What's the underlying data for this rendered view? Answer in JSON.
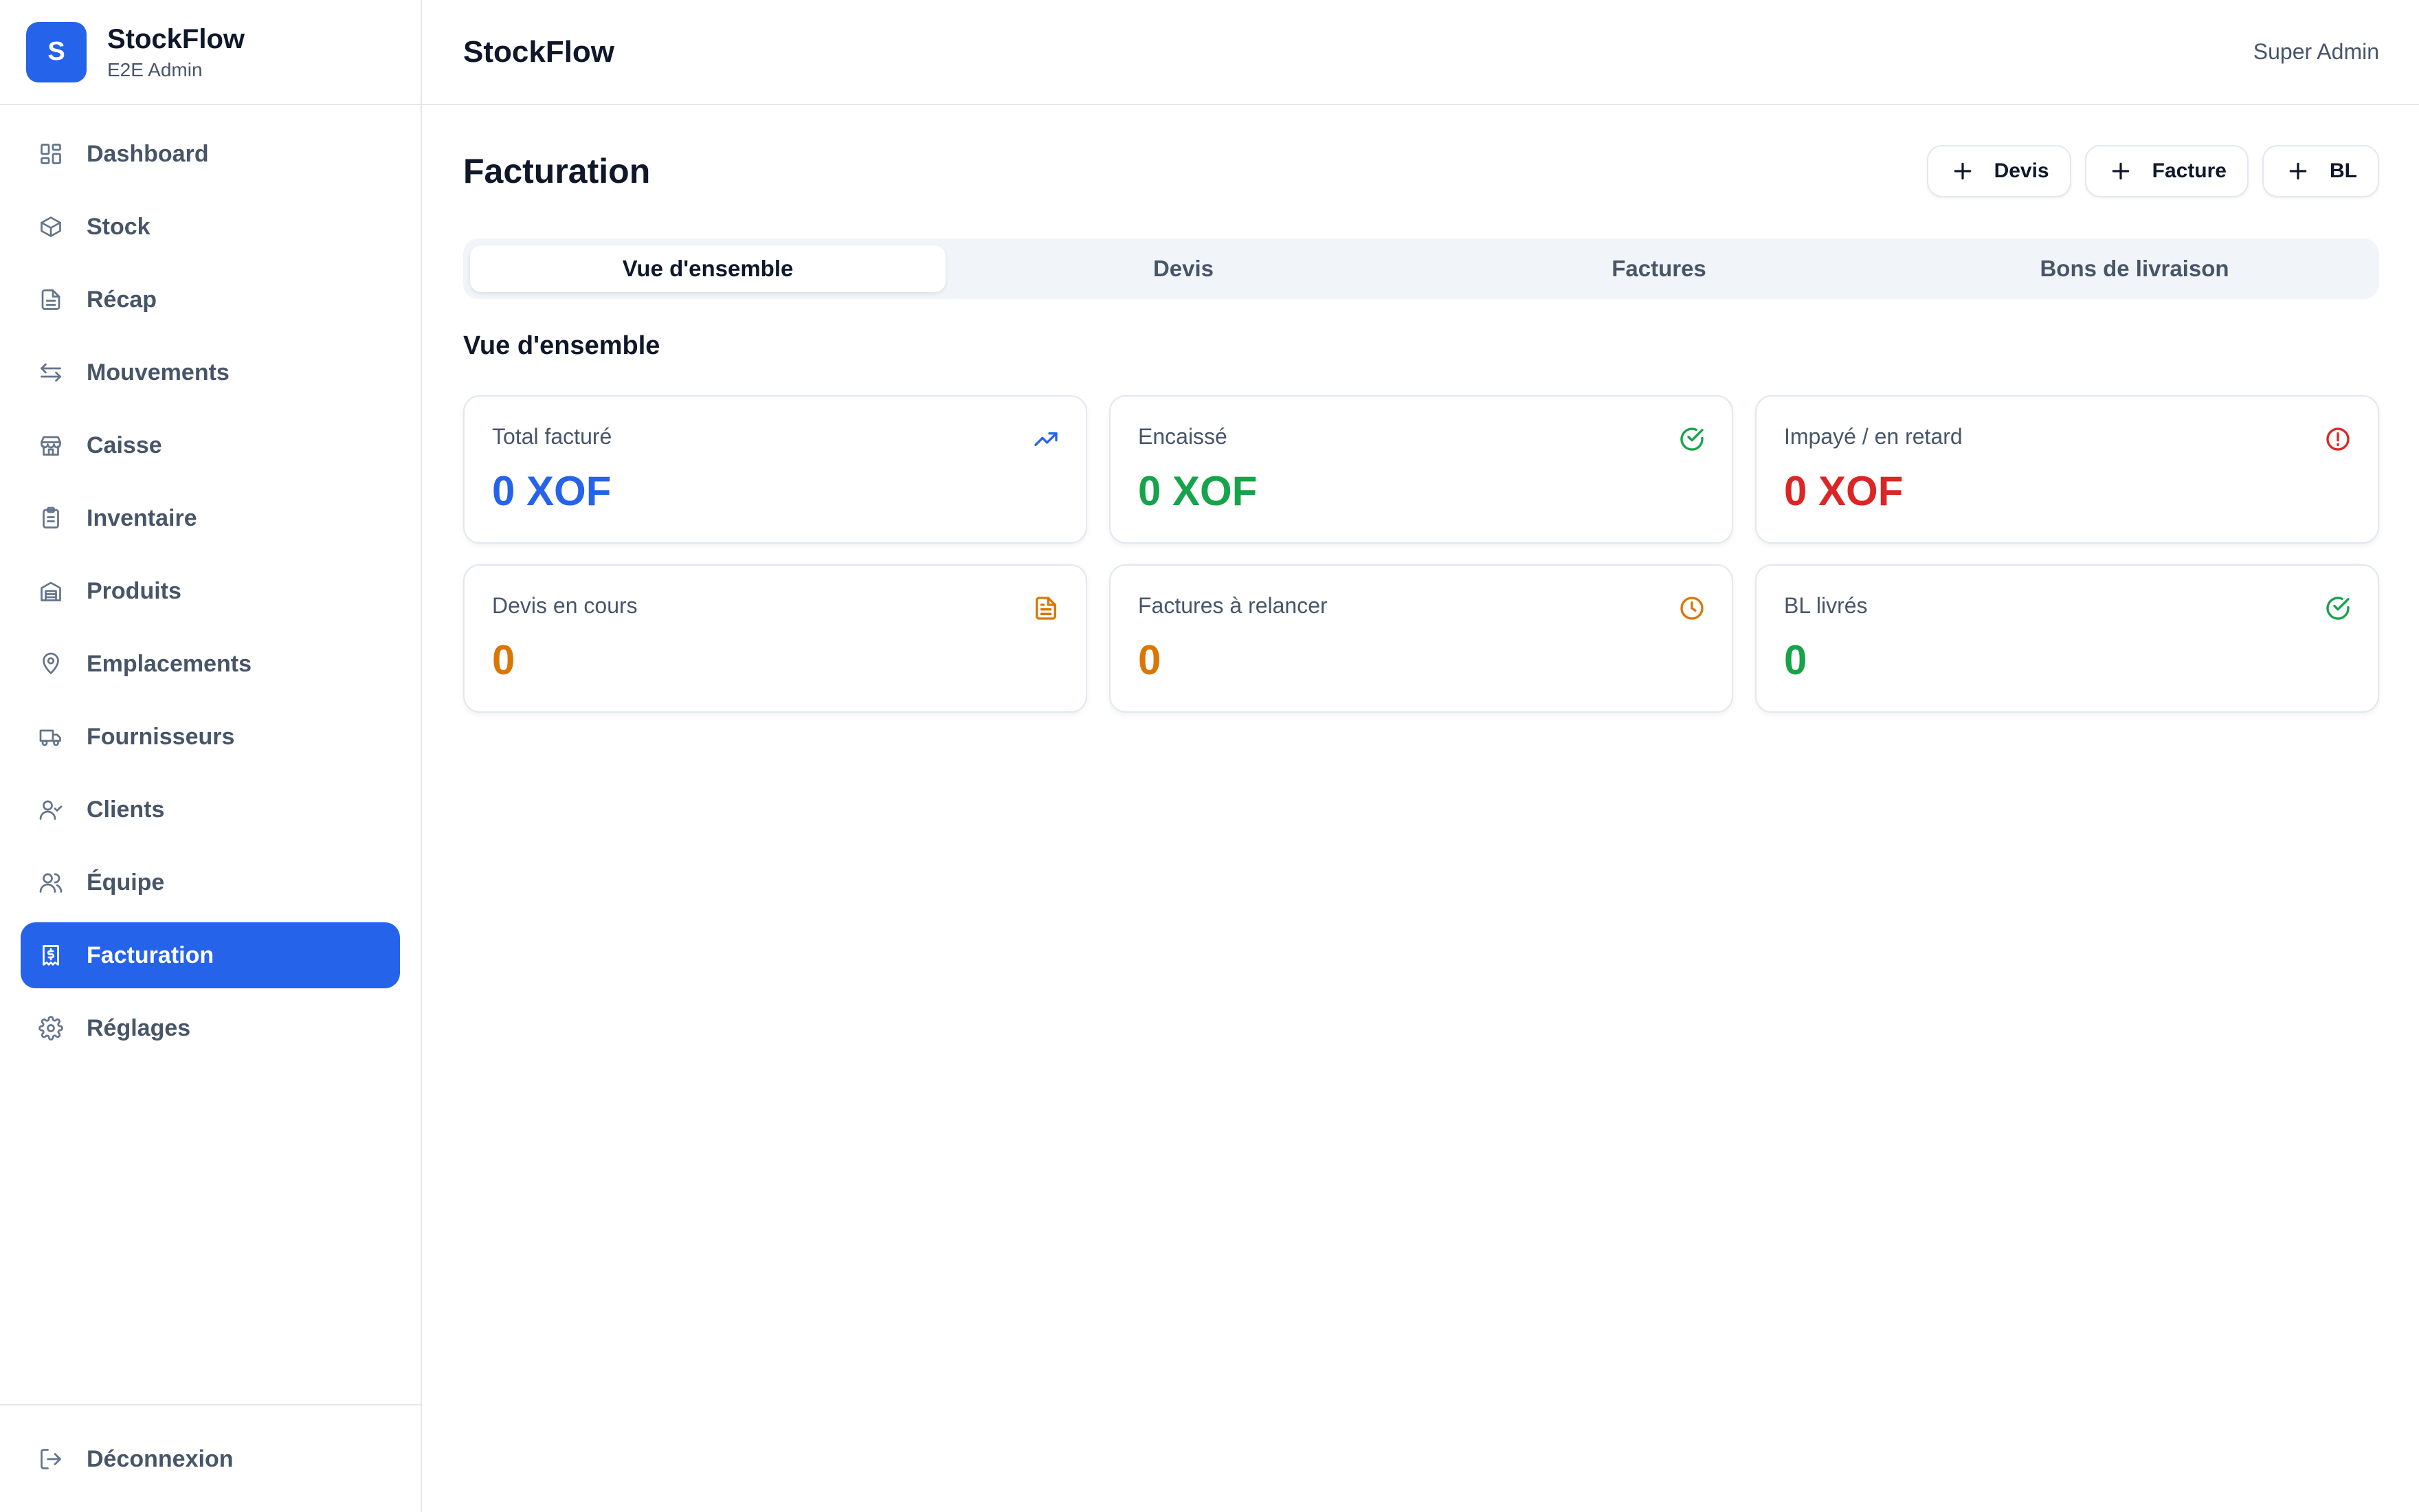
{
  "brand": {
    "logo_letter": "S",
    "name": "StockFlow",
    "subtitle": "E2E Admin"
  },
  "sidebar": {
    "items": [
      {
        "label": "Dashboard",
        "icon": "dashboard-grid-icon"
      },
      {
        "label": "Stock",
        "icon": "box-icon"
      },
      {
        "label": "Récap",
        "icon": "document-icon"
      },
      {
        "label": "Mouvements",
        "icon": "arrows-exchange-icon"
      },
      {
        "label": "Caisse",
        "icon": "store-icon"
      },
      {
        "label": "Inventaire",
        "icon": "clipboard-icon"
      },
      {
        "label": "Produits",
        "icon": "warehouse-icon"
      },
      {
        "label": "Emplacements",
        "icon": "map-pin-icon"
      },
      {
        "label": "Fournisseurs",
        "icon": "truck-icon"
      },
      {
        "label": "Clients",
        "icon": "user-check-icon"
      },
      {
        "label": "Équipe",
        "icon": "users-icon"
      },
      {
        "label": "Facturation",
        "icon": "receipt-icon",
        "active": true
      },
      {
        "label": "Réglages",
        "icon": "gear-icon"
      }
    ],
    "logout_label": "Déconnexion"
  },
  "topbar": {
    "title": "StockFlow",
    "user": "Super Admin"
  },
  "page": {
    "title": "Facturation",
    "actions": [
      {
        "label": "Devis"
      },
      {
        "label": "Facture"
      },
      {
        "label": "BL"
      }
    ],
    "tabs": [
      {
        "label": "Vue d'ensemble",
        "active": true
      },
      {
        "label": "Devis"
      },
      {
        "label": "Factures"
      },
      {
        "label": "Bons de livraison"
      }
    ],
    "section_title": "Vue d'ensemble",
    "cards": [
      {
        "label": "Total facturé",
        "value": "0 XOF",
        "icon": "trending-up-icon",
        "color": "#2563eb"
      },
      {
        "label": "Encaissé",
        "value": "0 XOF",
        "icon": "check-circle-icon",
        "color": "#16a34a"
      },
      {
        "label": "Impayé / en retard",
        "value": "0 XOF",
        "icon": "alert-circle-icon",
        "color": "#dc2626"
      },
      {
        "label": "Devis en cours",
        "value": "0",
        "icon": "file-text-icon",
        "color": "#d97706"
      },
      {
        "label": "Factures à relancer",
        "value": "0",
        "icon": "clock-icon",
        "color": "#d97706"
      },
      {
        "label": "BL livrés",
        "value": "0",
        "icon": "check-circle-icon",
        "color": "#16a34a"
      }
    ]
  }
}
